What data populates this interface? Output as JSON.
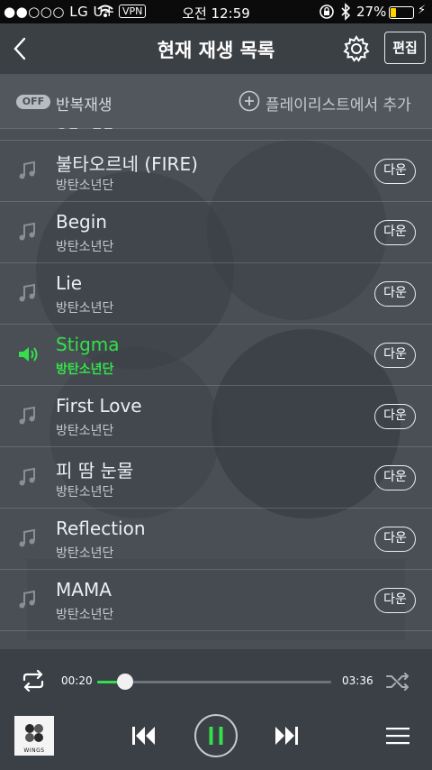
{
  "status_bar": {
    "carrier": "●●○○○ LG U+",
    "vpn": "VPN",
    "time": "오전 12:59",
    "battery_text": "27%",
    "battery_level": 0.27
  },
  "header": {
    "title": "현재 재생 목록",
    "edit_label": "편집"
  },
  "toolbar": {
    "repeat_toggle": "OFF",
    "repeat_label": "반복재생",
    "add_label": "플레이리스트에서 추가"
  },
  "tracks": [
    {
      "title": "피 땀 눈물",
      "artist": "방탄소년단",
      "action": "다운",
      "active": false
    },
    {
      "title": "불타오르네 (FIRE)",
      "artist": "방탄소년단",
      "action": "다운",
      "active": false
    },
    {
      "title": "Begin",
      "artist": "방탄소년단",
      "action": "다운",
      "active": false
    },
    {
      "title": "Lie",
      "artist": "방탄소년단",
      "action": "다운",
      "active": false
    },
    {
      "title": "Stigma",
      "artist": "방탄소년단",
      "action": "다운",
      "active": true
    },
    {
      "title": "First Love",
      "artist": "방탄소년단",
      "action": "다운",
      "active": false
    },
    {
      "title": "피 땀 눈물",
      "artist": "방탄소년단",
      "action": "다운",
      "active": false
    },
    {
      "title": "Reflection",
      "artist": "방탄소년단",
      "action": "다운",
      "active": false
    },
    {
      "title": "MAMA",
      "artist": "방탄소년단",
      "action": "다운",
      "active": false
    }
  ],
  "player": {
    "current_time": "00:20",
    "duration": "03:36",
    "progress": 0.12,
    "album_label": "WINGS"
  },
  "colors": {
    "accent": "#33e04a",
    "battery": "#ffd200",
    "background": "#4a4f55"
  }
}
